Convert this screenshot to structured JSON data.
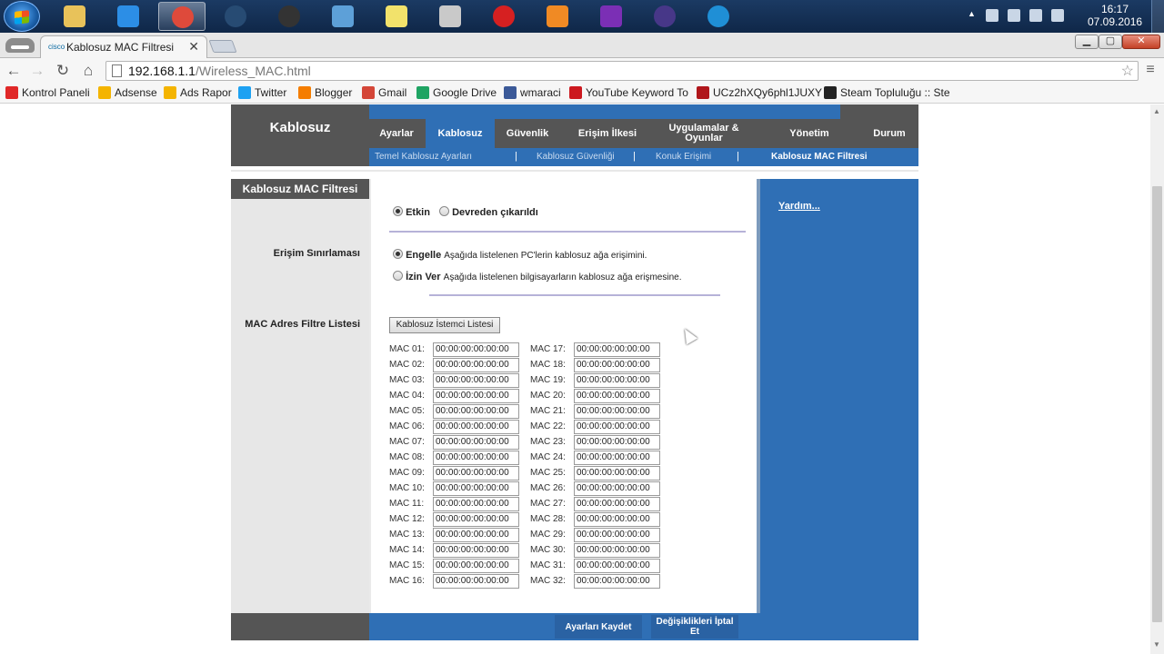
{
  "taskbar": {
    "apps": [
      {
        "name": "file-explorer",
        "color": "#e8c25a"
      },
      {
        "name": "internet-explorer",
        "color": "#2c8ee6"
      },
      {
        "name": "chrome",
        "color": "#de4a3b"
      },
      {
        "name": "steam",
        "color": "#274b73"
      },
      {
        "name": "obs",
        "color": "#333333"
      },
      {
        "name": "notepad",
        "color": "#5da0d8"
      },
      {
        "name": "sticky-notes",
        "color": "#f2e26b"
      },
      {
        "name": "paint",
        "color": "#c9c9c9"
      },
      {
        "name": "opera",
        "color": "#d62021"
      },
      {
        "name": "media-player",
        "color": "#f08a24"
      },
      {
        "name": "visual-studio",
        "color": "#7b2fb5"
      },
      {
        "name": "eclipse",
        "color": "#473788"
      },
      {
        "name": "ccleaner",
        "color": "#1f8fd6"
      }
    ],
    "clock": {
      "time": "16:17",
      "date": "07.09.2016"
    }
  },
  "browser": {
    "tab_title": "Kablosuz MAC Filtresi",
    "tab_favicon": "cisco",
    "tab_close": "✕",
    "url_host": "192.168.1.1",
    "url_path": "/Wireless_MAC.html",
    "bookmarks": [
      {
        "label": "Kontrol Paneli",
        "color": "#e02828"
      },
      {
        "label": "Adsense",
        "color": "#f4b400"
      },
      {
        "label": "Ads Rapor",
        "color": "#f4b400"
      },
      {
        "label": "Twitter",
        "color": "#1da1f2"
      },
      {
        "label": "Blogger",
        "color": "#f57d00"
      },
      {
        "label": "Gmail",
        "color": "#d44638"
      },
      {
        "label": "Google Drive",
        "color": "#1fa463"
      },
      {
        "label": "wmaraci",
        "color": "#3b5998"
      },
      {
        "label": "YouTube Keyword To",
        "color": "#cc181e"
      },
      {
        "label": "UCz2hXQy6phl1JUXY",
        "color": "#b0161b"
      },
      {
        "label": "Steam Topluluğu :: Ste",
        "color": "#222222"
      }
    ]
  },
  "router": {
    "section_title": "Kablosuz",
    "nav": [
      "Ayarlar",
      "Kablosuz",
      "Güvenlik",
      "Erişim İlkesi",
      "Uygulamalar & Oyunlar",
      "Yönetim",
      "Durum"
    ],
    "active_nav": "Kablosuz",
    "subnav": [
      "Temel Kablosuz Ayarları",
      "Kablosuz Güvenliği",
      "Konuk Erişimi",
      "Kablosuz MAC Filtresi"
    ],
    "sidebar_title": "Kablosuz MAC Filtresi",
    "labels": {
      "access_restriction": "Erişim Sınırlaması",
      "mac_filter_list": "MAC Adres Filtre Listesi"
    },
    "enable": {
      "on": "Etkin",
      "off": "Devreden çıkarıldı",
      "selected": "Etkin"
    },
    "restriction": {
      "block_label": "Engelle",
      "block_desc": "Aşağıda listelenen PC'lerin kablosuz ağa erişimini.",
      "allow_label": "İzin Ver",
      "allow_desc": "Aşağıda listelenen bilgisayarların kablosuz ağa erişmesine.",
      "selected": "Engelle"
    },
    "client_list_button": "Kablosuz İstemci Listesi",
    "mac_left": [
      {
        "label": "MAC 01:",
        "value": "00:00:00:00:00:00"
      },
      {
        "label": "MAC 02:",
        "value": "00:00:00:00:00:00"
      },
      {
        "label": "MAC 03:",
        "value": "00:00:00:00:00:00"
      },
      {
        "label": "MAC 04:",
        "value": "00:00:00:00:00:00"
      },
      {
        "label": "MAC 05:",
        "value": "00:00:00:00:00:00"
      },
      {
        "label": "MAC 06:",
        "value": "00:00:00:00:00:00"
      },
      {
        "label": "MAC 07:",
        "value": "00:00:00:00:00:00"
      },
      {
        "label": "MAC 08:",
        "value": "00:00:00:00:00:00"
      },
      {
        "label": "MAC 09:",
        "value": "00:00:00:00:00:00"
      },
      {
        "label": "MAC 10:",
        "value": "00:00:00:00:00:00"
      },
      {
        "label": "MAC 11:",
        "value": "00:00:00:00:00:00"
      },
      {
        "label": "MAC 12:",
        "value": "00:00:00:00:00:00"
      },
      {
        "label": "MAC 13:",
        "value": "00:00:00:00:00:00"
      },
      {
        "label": "MAC 14:",
        "value": "00:00:00:00:00:00"
      },
      {
        "label": "MAC 15:",
        "value": "00:00:00:00:00:00"
      },
      {
        "label": "MAC 16:",
        "value": "00:00:00:00:00:00"
      }
    ],
    "mac_right": [
      {
        "label": "MAC 17:",
        "value": "00:00:00:00:00:00"
      },
      {
        "label": "MAC 18:",
        "value": "00:00:00:00:00:00"
      },
      {
        "label": "MAC 19:",
        "value": "00:00:00:00:00:00"
      },
      {
        "label": "MAC 20:",
        "value": "00:00:00:00:00:00"
      },
      {
        "label": "MAC 21:",
        "value": "00:00:00:00:00:00"
      },
      {
        "label": "MAC 22:",
        "value": "00:00:00:00:00:00"
      },
      {
        "label": "MAC 23:",
        "value": "00:00:00:00:00:00"
      },
      {
        "label": "MAC 24:",
        "value": "00:00:00:00:00:00"
      },
      {
        "label": "MAC 25:",
        "value": "00:00:00:00:00:00"
      },
      {
        "label": "MAC 26:",
        "value": "00:00:00:00:00:00"
      },
      {
        "label": "MAC 27:",
        "value": "00:00:00:00:00:00"
      },
      {
        "label": "MAC 28:",
        "value": "00:00:00:00:00:00"
      },
      {
        "label": "MAC 29:",
        "value": "00:00:00:00:00:00"
      },
      {
        "label": "MAC 30:",
        "value": "00:00:00:00:00:00"
      },
      {
        "label": "MAC 31:",
        "value": "00:00:00:00:00:00"
      },
      {
        "label": "MAC 32:",
        "value": "00:00:00:00:00:00"
      }
    ],
    "help_link": "Yardım...",
    "save_button": "Ayarları Kaydet",
    "cancel_button": "Değişiklikleri İptal Et"
  },
  "colors": {
    "router_blue": "#2f6fb5",
    "router_gray": "#555555"
  }
}
